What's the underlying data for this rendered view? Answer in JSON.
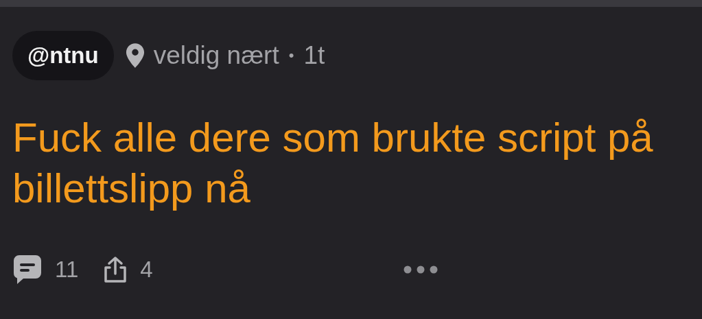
{
  "post": {
    "channel": "@ntnu",
    "location": "veldig nært",
    "separator": "•",
    "age": "1t",
    "text": "Fuck alle dere som brukte script på billettslipp nå",
    "comments": "11",
    "shares": "4"
  }
}
